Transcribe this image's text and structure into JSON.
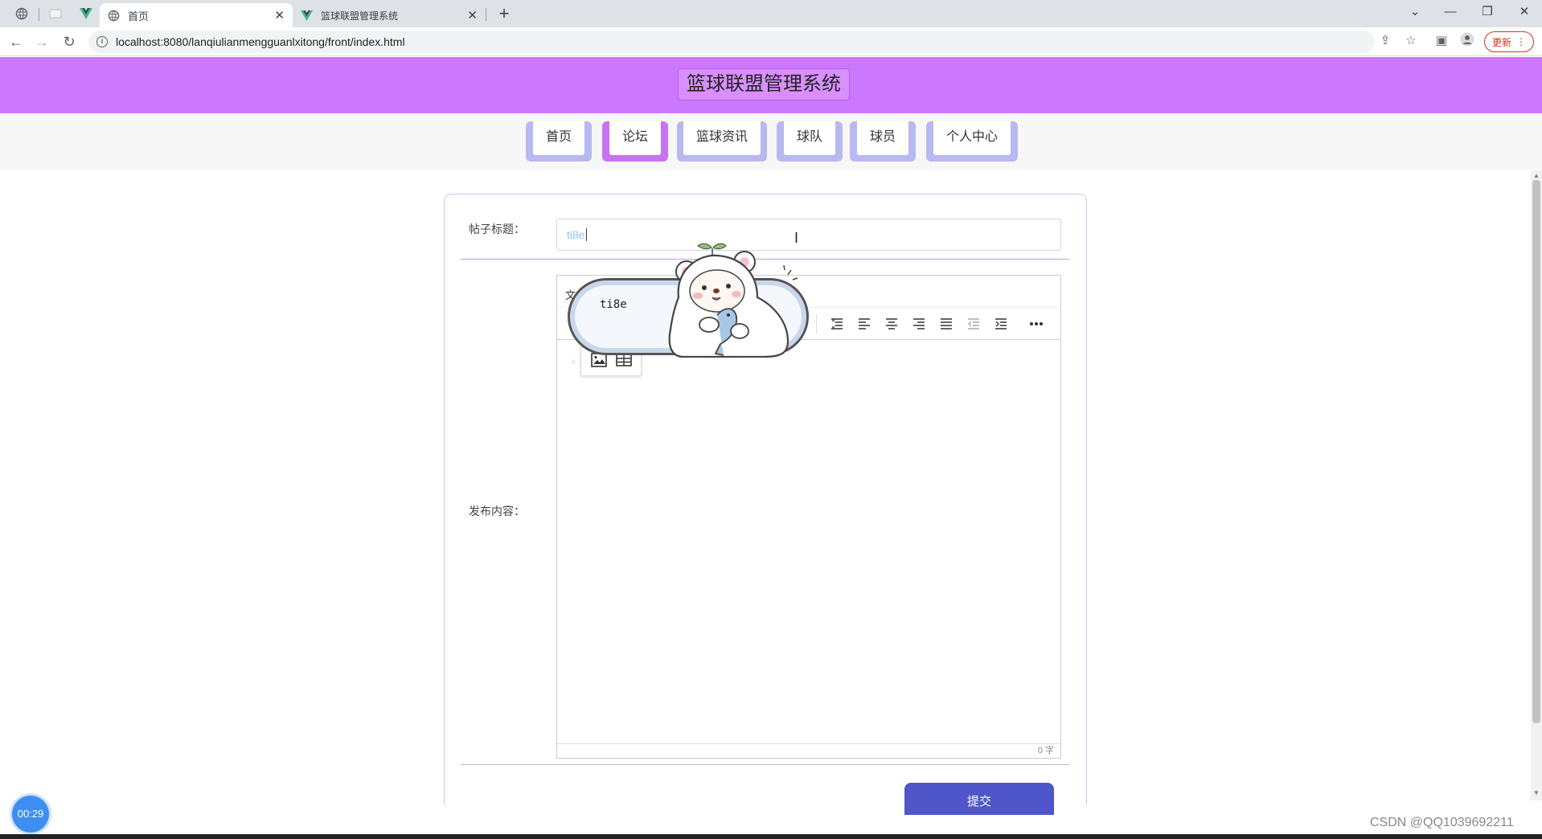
{
  "browser": {
    "tabs": [
      {
        "label": "首页",
        "icon": "globe-icon",
        "active": true
      },
      {
        "label": "篮球联盟管理系统",
        "icon": "vue-logo-icon",
        "active": false
      }
    ],
    "url": "localhost:8080/lanqiulianmengguanlxitong/front/index.html",
    "update_label": "更新"
  },
  "site": {
    "title": "篮球联盟管理系统",
    "accent_color": "#cc77ff",
    "nav": [
      {
        "label": "首页",
        "active": false
      },
      {
        "label": "论坛",
        "active": true
      },
      {
        "label": "篮球资讯",
        "active": false
      },
      {
        "label": "球队",
        "active": false
      },
      {
        "label": "球员",
        "active": false
      },
      {
        "label": "个人中心",
        "active": false
      }
    ]
  },
  "form": {
    "title_label": "帖子标题：",
    "title_value": "ti8e",
    "content_label": "发布内容：",
    "editor_menu_label": "文件",
    "word_count": "0 字",
    "submit_label": "提交"
  },
  "overlay": {
    "bubble_text": "ti8e",
    "timer": "00:29",
    "watermark": "CSDN @QQ1039692211"
  }
}
